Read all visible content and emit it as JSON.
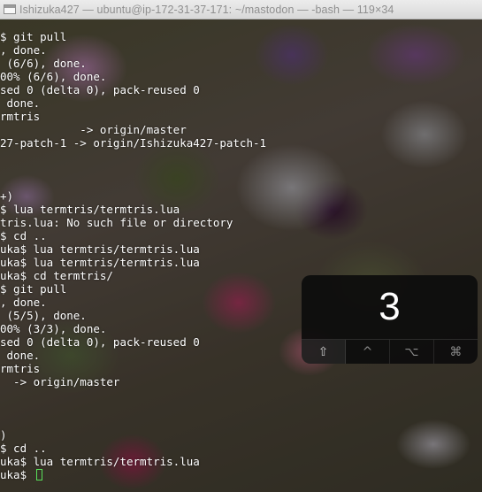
{
  "window": {
    "title": "Ishizuka427 — ubuntu@ip-172-31-37-171: ~/mastodon — -bash — 119×34"
  },
  "terminal": {
    "lines": [
      "$ git pull",
      ", done.",
      " (6/6), done.",
      "00% (6/6), done.",
      "sed 0 (delta 0), pack-reused 0",
      " done.",
      "rmtris",
      "            -> origin/master",
      "27-patch-1 -> origin/Ishizuka427-patch-1",
      "",
      "",
      "",
      "+)",
      "$ lua termtris/termtris.lua",
      "tris.lua: No such file or directory",
      "$ cd ..",
      "uka$ lua termtris/termtris.lua",
      "uka$ lua termtris/termtris.lua",
      "uka$ cd termtris/",
      "$ git pull",
      ", done.",
      " (5/5), done.",
      "00% (3/3), done.",
      "sed 0 (delta 0), pack-reused 0",
      " done.",
      "rmtris",
      "  -> origin/master",
      "",
      "",
      "",
      ")",
      "$ cd ..",
      "uka$ lua termtris/termtris.lua",
      "uka$ "
    ],
    "cursor_color": "#59e05a"
  },
  "key_overlay": {
    "key": "3",
    "modifiers": [
      {
        "name": "shift",
        "glyph": "⇧",
        "active": true
      },
      {
        "name": "control",
        "glyph": "^",
        "active": false
      },
      {
        "name": "option",
        "glyph": "⌥",
        "active": false
      },
      {
        "name": "command",
        "glyph": "⌘",
        "active": false
      }
    ]
  }
}
